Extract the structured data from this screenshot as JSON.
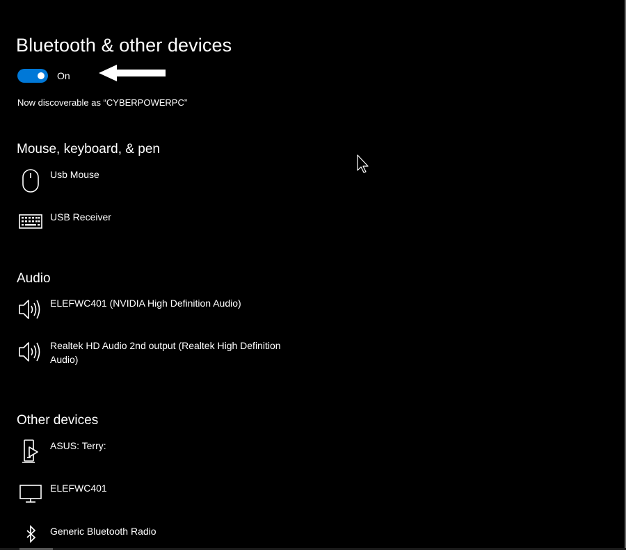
{
  "page": {
    "title": "Bluetooth & other devices"
  },
  "bluetooth": {
    "toggle_state": "On",
    "toggle_on": true,
    "discoverable_text": "Now discoverable as “CYBERPOWERPC”"
  },
  "sections": {
    "mouse_keyboard_pen": {
      "title": "Mouse, keyboard, & pen",
      "devices": [
        {
          "label": "Usb Mouse",
          "icon": "mouse-icon"
        },
        {
          "label": "USB Receiver",
          "icon": "keyboard-icon"
        }
      ]
    },
    "audio": {
      "title": "Audio",
      "devices": [
        {
          "label": "ELEFWC401 (NVIDIA High Definition Audio)",
          "icon": "speaker-icon"
        },
        {
          "label": "Realtek HD Audio 2nd output (Realtek High Definition Audio)",
          "icon": "speaker-icon"
        }
      ]
    },
    "other_devices": {
      "title": "Other devices",
      "devices": [
        {
          "label": "ASUS: Terry:",
          "icon": "media-device-icon"
        },
        {
          "label": "ELEFWC401",
          "icon": "monitor-icon"
        },
        {
          "label": "Generic Bluetooth Radio",
          "icon": "bluetooth-icon"
        }
      ]
    }
  },
  "colors": {
    "background": "#000000",
    "text": "#ffffff",
    "accent": "#0078d7"
  }
}
